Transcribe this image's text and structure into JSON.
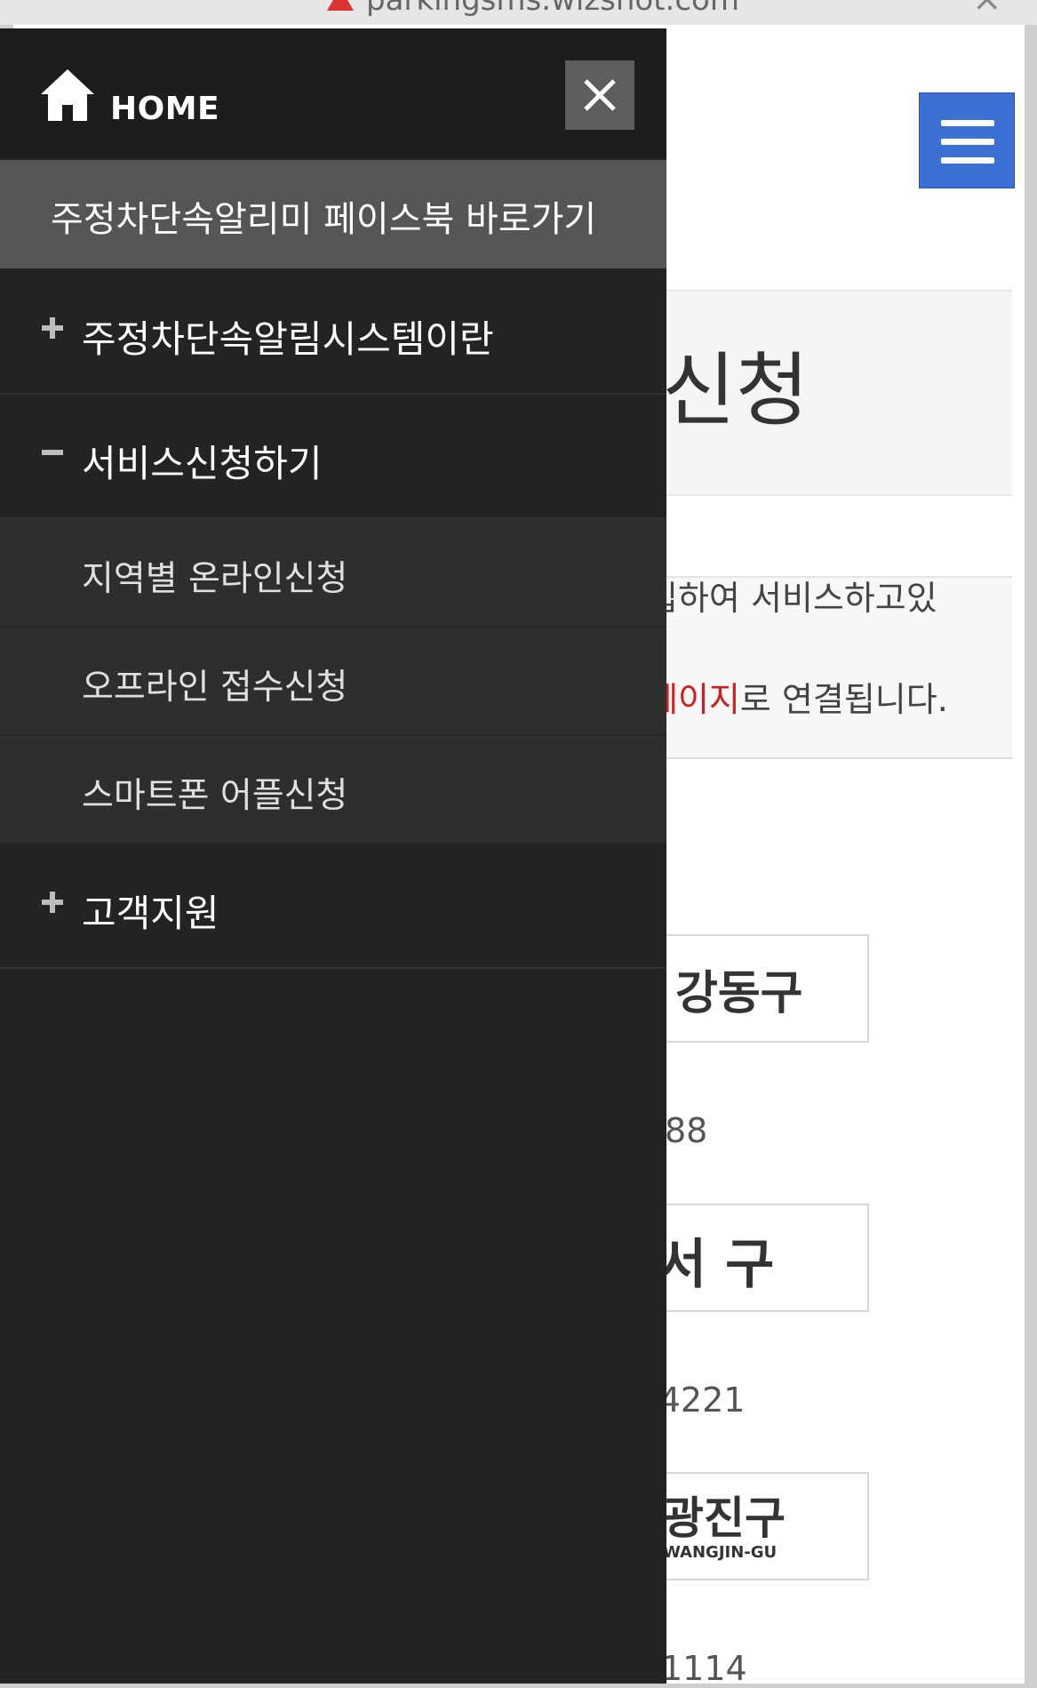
{
  "browser": {
    "url": "parkingsms.wizshot.com"
  },
  "page": {
    "hero_title": "신청",
    "notice_line1": "입하여 서비스하고있",
    "notice_red": "페이지",
    "notice_rest": "로 연결됩니다.",
    "districts": [
      {
        "logo_text": "강동구",
        "phone": "88"
      },
      {
        "logo_text": "서 구",
        "phone": "-4221"
      },
      {
        "logo_text": "광진구",
        "logo_sub": "WANGJIN-GU",
        "phone": "1114"
      }
    ]
  },
  "drawer": {
    "home_label": "HOME",
    "facebook_link": "주정차단속알리미 페이스북 바로가기",
    "menu": [
      {
        "sign": "+",
        "label": "주정차단속알림시스템이란"
      },
      {
        "sign": "−",
        "label": "서비스신청하기",
        "children": [
          "지역별 온라인신청",
          "오프라인 접수신청",
          "스마트폰 어플신청"
        ]
      },
      {
        "sign": "+",
        "label": "고객지원"
      }
    ]
  },
  "colors": {
    "drawer_bg": "#232323",
    "fb_link_bg": "#555555",
    "submenu_bg": "#2e2e2e",
    "hamburger_bg": "#3b6fd1",
    "link_red": "#d01f1f"
  },
  "icons": [
    "warning-icon",
    "close-tab-icon",
    "home-icon",
    "close-icon",
    "plus-icon",
    "minus-icon",
    "hamburger-menu-icon"
  ]
}
